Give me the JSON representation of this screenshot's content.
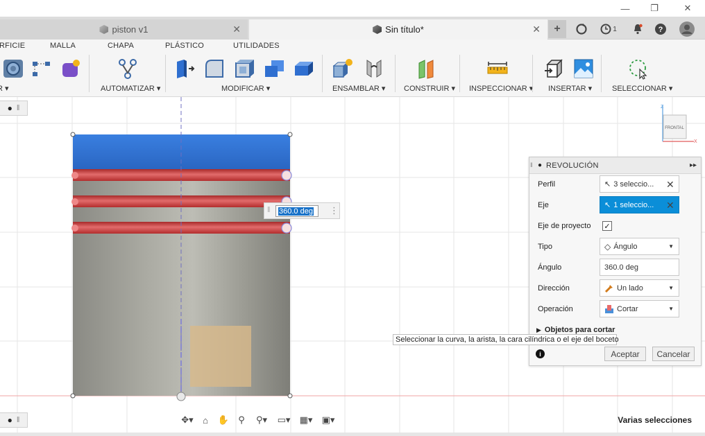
{
  "window": {
    "minimize_glyph": "—",
    "restore_glyph": "❐",
    "close_glyph": "✕"
  },
  "tabs": [
    {
      "label": "piston v1",
      "close_glyph": "✕",
      "active": false
    },
    {
      "label": "Sin título*",
      "close_glyph": "✕",
      "active": true
    }
  ],
  "tabbar_icons": {
    "new_tab": "+",
    "job_status_icon": "sync-icon",
    "timer_count": "1",
    "notifications_icon": "bell-icon",
    "help_icon": "question-icon",
    "profile_icon": "avatar-icon"
  },
  "ribbon_tabs": [
    "RFICIE",
    "MALLA",
    "CHAPA",
    "PLÁSTICO",
    "UTILIDADES"
  ],
  "ribbon_groups": [
    {
      "label": "R ▾"
    },
    {
      "label": "AUTOMATIZAR ▾"
    },
    {
      "label": "MODIFICAR ▾"
    },
    {
      "label": "ENSAMBLAR ▾"
    },
    {
      "label": "CONSTRUIR ▾"
    },
    {
      "label": "INSPECCIONAR ▾"
    },
    {
      "label": "INSERTAR ▾"
    },
    {
      "label": "SELECCIONAR ▾"
    }
  ],
  "viewcube": {
    "face_label": "FRONTAL",
    "axis_z": "Z",
    "axis_x": "X"
  },
  "angle_input": {
    "value": "360.0 deg"
  },
  "panel": {
    "title": "REVOLUCIÓN",
    "rows": [
      {
        "label": "Perfil",
        "value": "3 seleccio..."
      },
      {
        "label": "Eje",
        "value": "1 seleccio..."
      },
      {
        "label": "Eje de proyecto",
        "checked_glyph": "✓"
      },
      {
        "label": "Tipo",
        "value": "Ángulo"
      },
      {
        "label": "Ángulo",
        "value": "360.0 deg"
      },
      {
        "label": "Dirección",
        "value": "Un lado"
      },
      {
        "label": "Operación",
        "value": "Cortar"
      }
    ],
    "objects_to_cut": "Objetos para cortar",
    "info_glyph": "i",
    "accept": "Aceptar",
    "cancel": "Cancelar"
  },
  "tooltip": "Seleccionar la curva, la arista, la cara cilíndrica o el eje del boceto",
  "status": {
    "selection": "Varias selecciones"
  },
  "colors": {
    "accent_blue": "#0b8ed8",
    "body_blue": "#2f74d6",
    "groove_red": "#d23a3a",
    "body_grey": "#9a9a92",
    "profile_tan": "#d8b98a"
  }
}
